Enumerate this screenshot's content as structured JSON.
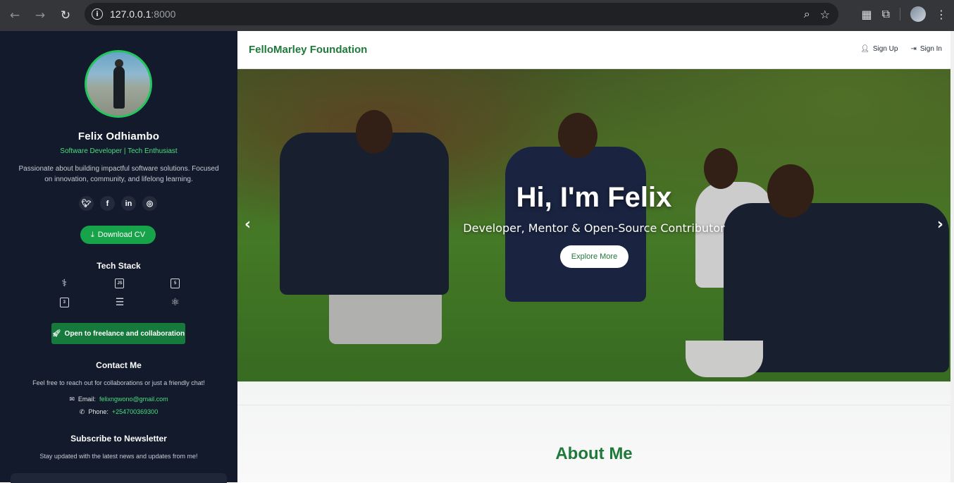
{
  "browser": {
    "url_host": "127.0.0.1",
    "url_port": ":8000"
  },
  "sidebar": {
    "name": "Felix Odhiambo",
    "role": "Software Developer | Tech Enthusiast",
    "bio": "Passionate about building impactful software solutions. Focused on innovation, community, and lifelong learning.",
    "socials": [
      "twitter",
      "facebook",
      "linkedin",
      "instagram"
    ],
    "download_cv": "Download CV",
    "tech_stack_title": "Tech Stack",
    "tech_icons": [
      "python-icon",
      "js-icon",
      "html5-icon",
      "css3-icon",
      "database-icon",
      "react-icon"
    ],
    "freelance_label": "Open to freelance and collaboration",
    "contact_title": "Contact Me",
    "contact_note": "Feel free to reach out for collaborations or just a friendly chat!",
    "email_label": "Email:",
    "email_value": "felixngwono@gmail.com",
    "phone_label": "Phone:",
    "phone_value": "+254700369300",
    "newsletter_title": "Subscribe to Newsletter",
    "newsletter_note": "Stay updated with the latest news and updates from me!"
  },
  "main": {
    "brand": "FelloMarley Foundation",
    "nav": {
      "signup": "Sign Up",
      "signin": "Sign In"
    },
    "hero": {
      "title": "Hi, I'm Felix",
      "subtitle": "Developer, Mentor & Open-Source Contributor",
      "cta": "Explore More"
    },
    "about_title": "About Me"
  },
  "colors": {
    "accent_green": "#16a34a",
    "brand_green": "#1f7a3a",
    "sidebar_bg": "#131a2b"
  }
}
